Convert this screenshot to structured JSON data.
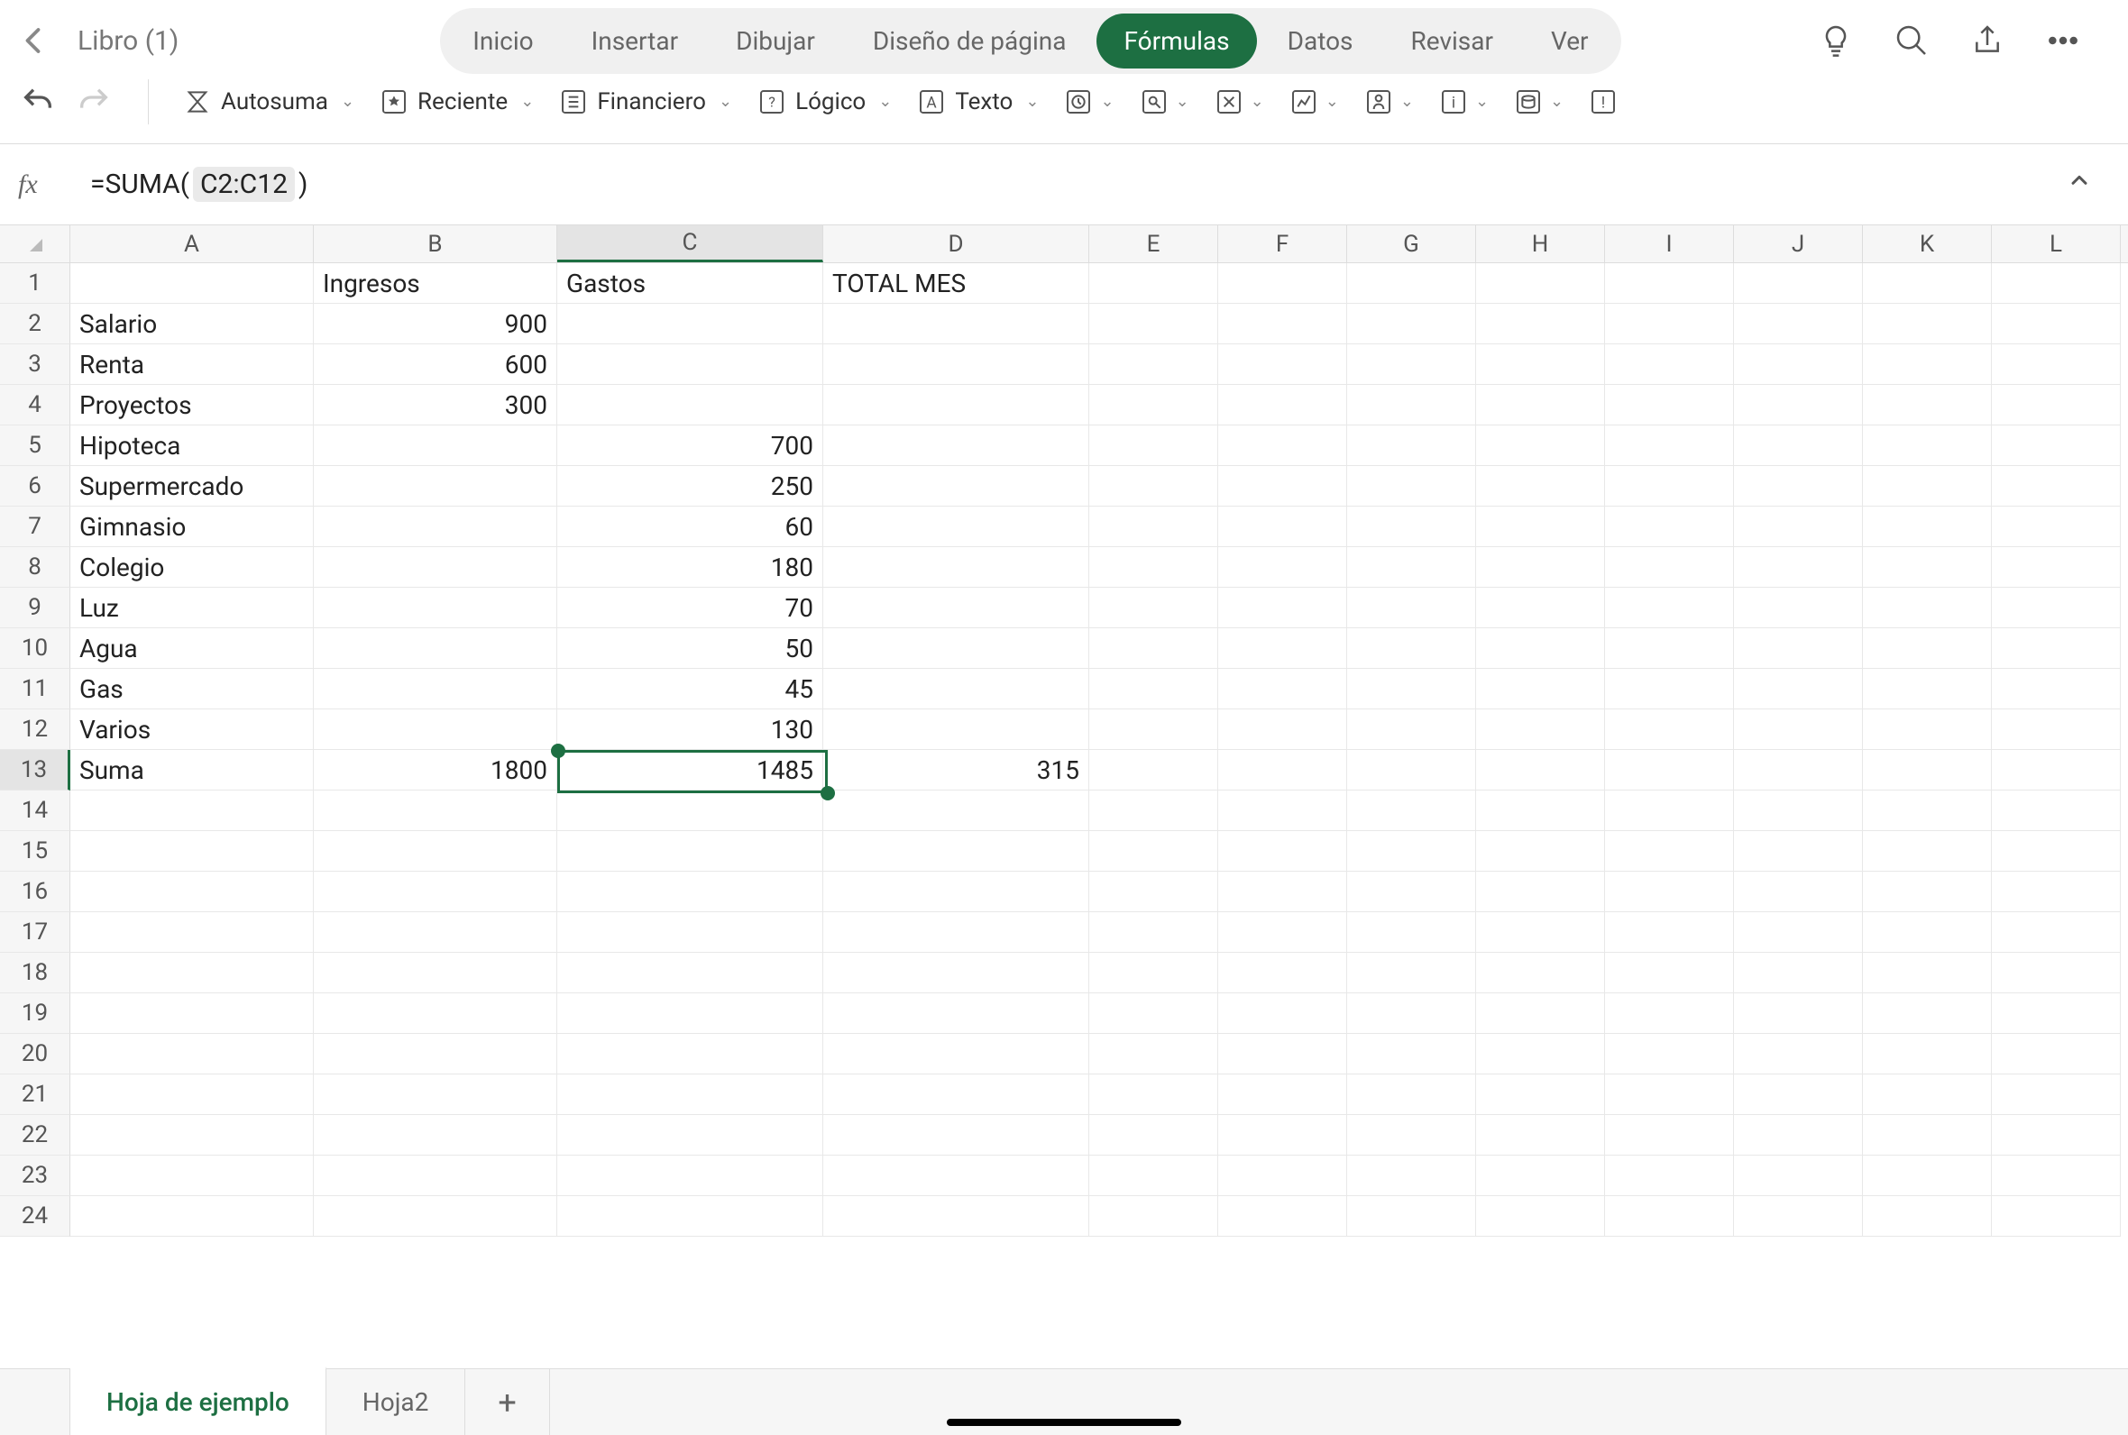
{
  "header": {
    "doc_title": "Libro (1)",
    "tabs": [
      "Inicio",
      "Insertar",
      "Dibujar",
      "Diseño de página",
      "Fórmulas",
      "Datos",
      "Revisar",
      "Ver"
    ],
    "active_tab": "Fórmulas"
  },
  "ribbon": {
    "autosum": "Autosuma",
    "recent": "Reciente",
    "financial": "Financiero",
    "logical": "Lógico",
    "text": "Texto"
  },
  "formula_bar": {
    "fx": "fx",
    "prefix": "=SUMA(",
    "range": "C2:C12",
    "suffix": ")"
  },
  "columns": [
    "A",
    "B",
    "C",
    "D",
    "E",
    "F",
    "G",
    "H",
    "I",
    "J",
    "K",
    "L"
  ],
  "selected_column": "C",
  "selected_row": 13,
  "cells": {
    "B1": "Ingresos",
    "C1": "Gastos",
    "D1": "TOTAL MES",
    "A2": "Salario",
    "B2": "900",
    "A3": "Renta",
    "B3": "600",
    "A4": "Proyectos",
    "B4": "300",
    "A5": "Hipoteca",
    "C5": "700",
    "A6": "Supermercado",
    "C6": "250",
    "A7": "Gimnasio",
    "C7": "60",
    "A8": "Colegio",
    "C8": "180",
    "A9": "Luz",
    "C9": "70",
    "A10": "Agua",
    "C10": "50",
    "A11": "Gas",
    "C11": "45",
    "A12": "Varios",
    "C12": "130",
    "A13": "Suma",
    "B13": "1800",
    "C13": "1485",
    "D13": "315"
  },
  "row_count": 24,
  "sheets": {
    "items": [
      "Hoja de ejemplo",
      "Hoja2"
    ],
    "active": "Hoja de ejemplo"
  }
}
